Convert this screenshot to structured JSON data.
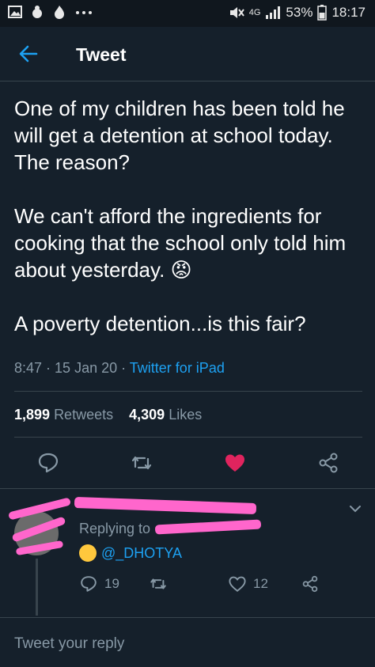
{
  "status_bar": {
    "signal_label": "4G",
    "battery": "53%",
    "time": "18:17"
  },
  "header": {
    "title": "Tweet"
  },
  "tweet": {
    "text": "One of my children has been told he will get a detention at school today. The reason?\n\nWe can't afford the ingredients for cooking that the school only told him about yesterday. 😡\n\nA poverty detention...is this fair?",
    "time": "8:47",
    "date": "15 Jan 20",
    "source": "Twitter for iPad",
    "retweets_count": "1,899",
    "retweets_label": "Retweets",
    "likes_count": "4,309",
    "likes_label": "Likes"
  },
  "reply": {
    "replying_to_label": "Replying to",
    "mention": "@_DHOTYA",
    "reply_count": "19",
    "like_count": "12"
  },
  "compose": {
    "placeholder": "Tweet your reply"
  },
  "colors": {
    "accent": "#1da1f2",
    "like": "#e0245e",
    "background": "#15202b",
    "muted": "#8899a6"
  },
  "icons": [
    "back-arrow-icon",
    "reply-icon",
    "retweet-icon",
    "heart-filled-icon",
    "share-icon",
    "chevron-down-icon"
  ]
}
